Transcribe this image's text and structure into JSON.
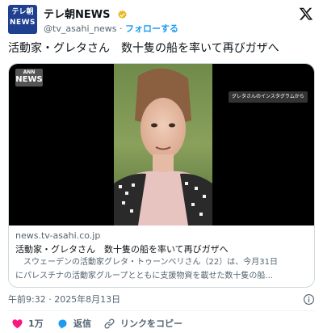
{
  "account": {
    "avatar_line1": "テレ朝",
    "avatar_line2": "NEWS",
    "display_name": "テレ朝NEWS",
    "handle": "@tv_asahi_news",
    "separator": "·",
    "follow_label": "フォローする"
  },
  "tweet": {
    "text": "活動家・グレタさん　数十隻の船を率いて再びガザへ"
  },
  "card": {
    "media_logo_top": "ANN",
    "media_logo_main": "NEWS",
    "media_caption": "グレタさんのインスタグラムから",
    "media_subtitle": "",
    "domain": "news.tv-asahi.co.jp",
    "title": "活動家・グレタさん　数十隻の船を率いて再びガザへ",
    "desc_line1": "　スウェーデンの活動家グレタ・トゥーンベリさん（22）は、今月31日",
    "desc_line2": "にパレスチナの活動家グループとともに支援物資を載せた数十隻の船..."
  },
  "meta": {
    "timestamp": "午前9:32 · 2025年8月13日"
  },
  "actions": {
    "like_count": "1万",
    "reply_label": "返信",
    "copy_link_label": "リンクをコピー"
  },
  "colors": {
    "accent": "#1d9bf0",
    "like": "#f91880",
    "avatar_bg": "#1f3f8f"
  },
  "icons": [
    "verified-badge-icon",
    "x-logo-icon",
    "info-icon",
    "heart-icon",
    "reply-icon",
    "link-icon"
  ]
}
